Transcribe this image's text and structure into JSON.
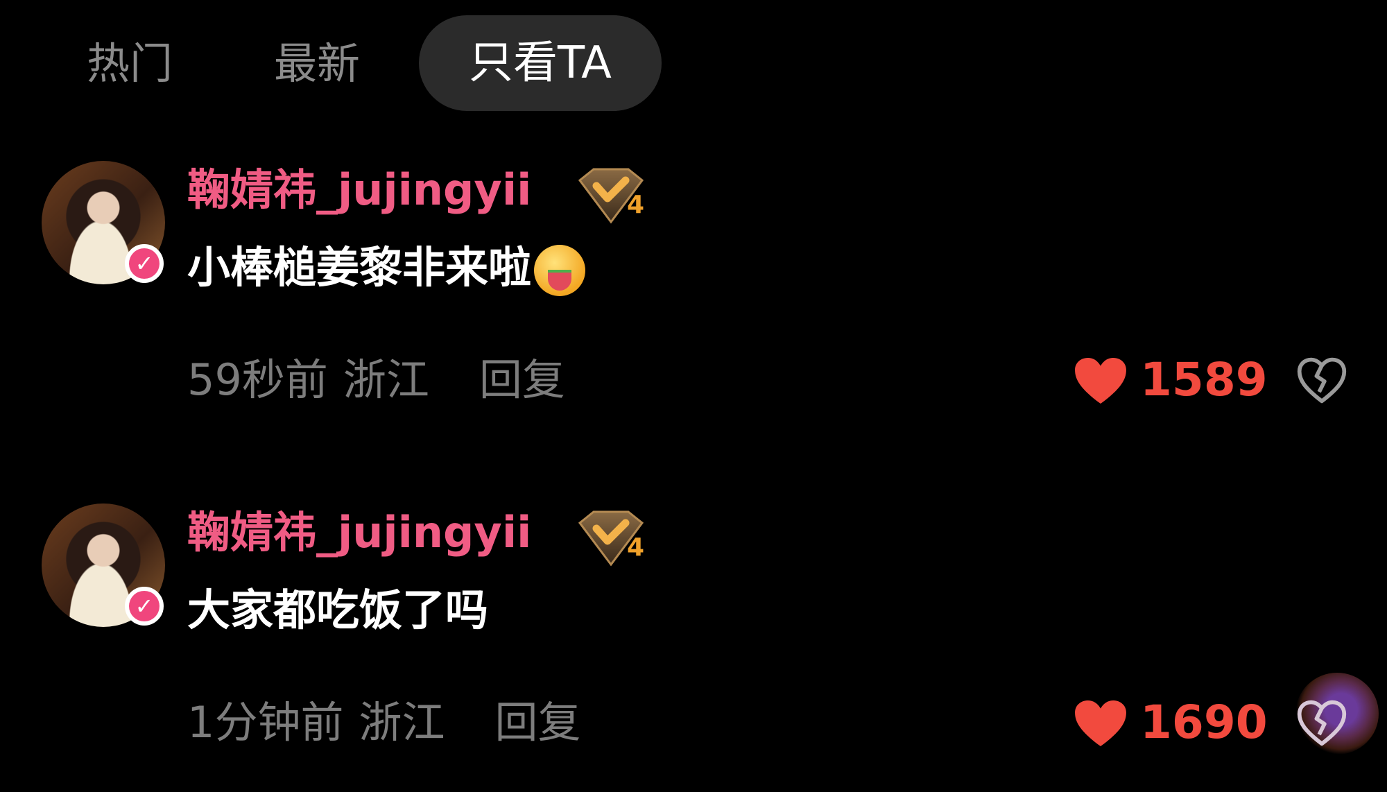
{
  "tabs": [
    {
      "label": "热门"
    },
    {
      "label": "最新"
    },
    {
      "label": "只看TA",
      "active": true
    }
  ],
  "comments": [
    {
      "username": "鞠婧祎_jujingyii",
      "level": "4",
      "text": "小棒槌姜黎非来啦",
      "emoji": "watermelon-face-emoji",
      "time": "59秒前",
      "location": "浙江",
      "reply_label": "回复",
      "likes": "1589"
    },
    {
      "username": "鞠婧祎_jujingyii",
      "level": "4",
      "text": "大家都吃饭了吗",
      "time": "1分钟前",
      "location": "浙江",
      "reply_label": "回复",
      "likes": "1690"
    }
  ],
  "colors": {
    "background": "#000000",
    "username": "#f05c84",
    "like": "#f24a3e",
    "meta": "#7d7d7d",
    "active_tab_bg": "#2b2b2b"
  }
}
